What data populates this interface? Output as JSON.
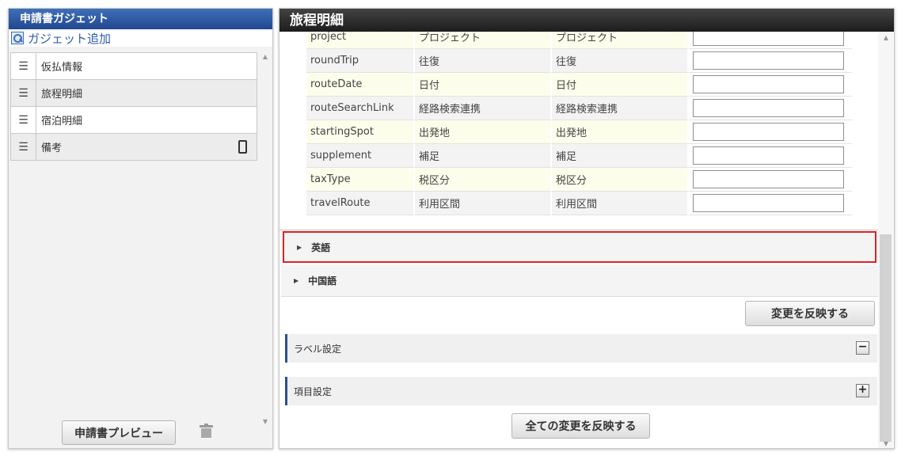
{
  "left_panel": {
    "title": "申請書ガジェット",
    "add_link": "ガジェット追加",
    "items": [
      {
        "label": "仮払情報"
      },
      {
        "label": "旅程明細"
      },
      {
        "label": "宿泊明細"
      },
      {
        "label": "備考"
      }
    ],
    "preview_button": "申請書プレビュー"
  },
  "right_panel": {
    "title": "旅程明細",
    "rows": [
      {
        "key": "project",
        "ja": "プロジェクト",
        "default": "プロジェクト",
        "value": ""
      },
      {
        "key": "roundTrip",
        "ja": "往復",
        "default": "往復",
        "value": ""
      },
      {
        "key": "routeDate",
        "ja": "日付",
        "default": "日付",
        "value": ""
      },
      {
        "key": "routeSearchLink",
        "ja": "経路検索連携",
        "default": "経路検索連携",
        "value": ""
      },
      {
        "key": "startingSpot",
        "ja": "出発地",
        "default": "出発地",
        "value": ""
      },
      {
        "key": "supplement",
        "ja": "補足",
        "default": "補足",
        "value": ""
      },
      {
        "key": "taxType",
        "ja": "税区分",
        "default": "税区分",
        "value": ""
      },
      {
        "key": "travelRoute",
        "ja": "利用区間",
        "default": "利用区間",
        "value": ""
      }
    ],
    "accordion_english": "英語",
    "accordion_chinese": "中国語",
    "apply_button": "変更を反映する",
    "section_label": "ラベル設定",
    "section_item": "項目設定",
    "collapse_symbol": "−",
    "expand_symbol": "+",
    "apply_all_button": "全ての変更を反映する"
  },
  "colors": {
    "left_header": "#2e5a9f",
    "right_header": "#2a2a2a",
    "highlight_border": "#e02020",
    "row_yellow": "#fdfdec",
    "link": "#2e5eb1"
  }
}
